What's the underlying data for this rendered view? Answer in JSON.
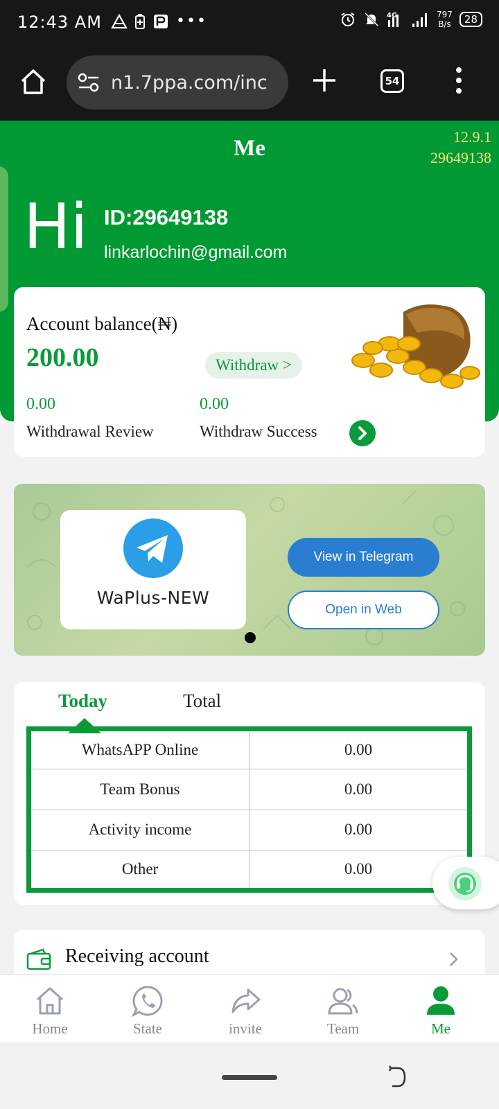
{
  "status_bar": {
    "time": "12:43 AM",
    "net_speed_value": "797",
    "net_speed_unit": "B/s",
    "battery": "28",
    "left_icons": [
      "nav-triangle-icon",
      "battery-saver-icon",
      "nfc-icon",
      "more-dots-icon"
    ],
    "right_icons": [
      "alarm-icon",
      "mute-icon",
      "4g-signal-icon",
      "signal-icon"
    ]
  },
  "browser": {
    "url": "n1.7ppa.com/inc",
    "tab_count": "54"
  },
  "header": {
    "title": "Me",
    "version": "12.9.1",
    "version_id": "29649138",
    "greeting": "Hi",
    "user_id": "ID:29649138",
    "email": "linkarlochin@gmail.com"
  },
  "balance": {
    "label": "Account balance(₦)",
    "amount": "200.00",
    "withdraw_label": "Withdraw >",
    "review_value": "0.00",
    "review_label": "Withdrawal Review",
    "success_value": "0.00",
    "success_label": "Withdraw Success"
  },
  "banner": {
    "channel_name": "WaPlus-NEW",
    "view_telegram_label": "View in Telegram",
    "open_web_label": "Open in Web"
  },
  "income": {
    "tabs": [
      "Today",
      "Total"
    ],
    "active_tab": "Today",
    "rows": [
      {
        "label": "WhatsAPP Online",
        "value": "0.00"
      },
      {
        "label": "Team Bonus",
        "value": "0.00"
      },
      {
        "label": "Activity income",
        "value": "0.00"
      },
      {
        "label": "Other",
        "value": "0.00"
      }
    ]
  },
  "receiving": {
    "label": "Receiving account"
  },
  "nav": {
    "items": [
      {
        "label": "Home",
        "icon": "home-icon"
      },
      {
        "label": "State",
        "icon": "whatsapp-icon"
      },
      {
        "label": "invite",
        "icon": "share-icon"
      },
      {
        "label": "Team",
        "icon": "team-icon"
      },
      {
        "label": "Me",
        "icon": "user-icon"
      }
    ],
    "active": "Me"
  },
  "colors": {
    "brand_green": "#009933",
    "accent_green": "#0a9a3a",
    "telegram_blue": "#2a7ed1",
    "version_yellow": "#f6e27a"
  }
}
